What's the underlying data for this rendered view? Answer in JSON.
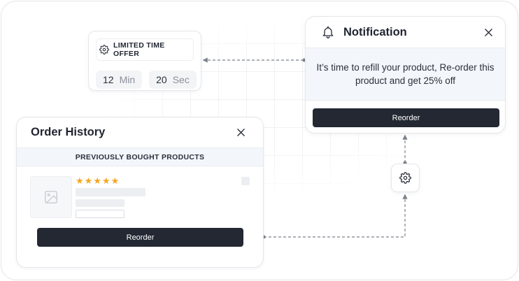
{
  "offer": {
    "title": "LIMITED TIME OFFER",
    "icon": "gear-icon",
    "minutes": {
      "value": "12",
      "unit": "Min"
    },
    "seconds": {
      "value": "20",
      "unit": "Sec"
    }
  },
  "notification": {
    "icon": "bell-icon",
    "title": "Notification",
    "message": "It’s time to refill your product, Re-order this product and get 25% off",
    "button_label": "Reorder"
  },
  "order_history": {
    "title": "Order History",
    "subtitle": "PREVIOUSLY BOUGHT PRODUCTS",
    "rating": 5,
    "button_label": "Reorder"
  },
  "colors": {
    "dark": "#232833",
    "star": "#f5a623",
    "panel_bg": "#f3f6fb",
    "border": "#e4e6ea",
    "connector": "#7b808a"
  }
}
